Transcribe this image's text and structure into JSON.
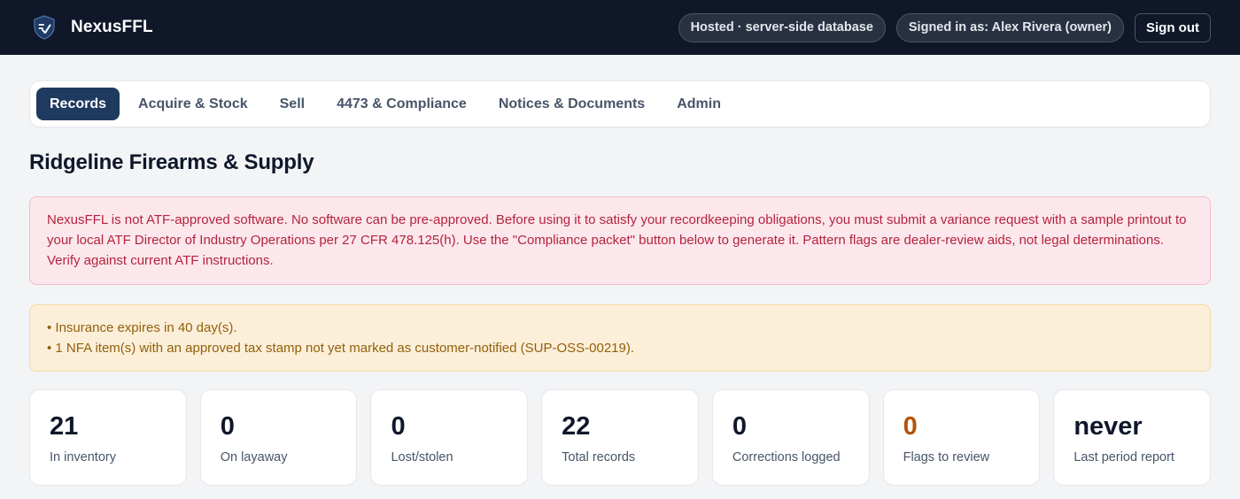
{
  "app": {
    "name": "NexusFFL",
    "logo_icon": "shield-check-icon"
  },
  "header": {
    "hosting_badge": "Hosted · server-side database",
    "signed_in_badge": "Signed in as: Alex Rivera (owner)",
    "sign_out_label": "Sign out"
  },
  "tabs": [
    {
      "label": "Records",
      "active": true
    },
    {
      "label": "Acquire & Stock",
      "active": false
    },
    {
      "label": "Sell",
      "active": false
    },
    {
      "label": "4473 & Compliance",
      "active": false
    },
    {
      "label": "Notices & Documents",
      "active": false
    },
    {
      "label": "Admin",
      "active": false
    }
  ],
  "page": {
    "title": "Ridgeline Firearms & Supply"
  },
  "alerts": {
    "danger_text": "NexusFFL is not ATF-approved software. No software can be pre-approved. Before using it to satisfy your recordkeeping obligations, you must submit a variance request with a sample printout to your local ATF Director of Industry Operations per 27 CFR 478.125(h). Use the \"Compliance packet\" button below to generate it. Pattern flags are dealer-review aids, not legal determinations. Verify against current ATF instructions.",
    "warnings": [
      "• Insurance expires in 40 day(s).",
      "• 1 NFA item(s) with an approved tax stamp not yet marked as customer-notified (SUP-OSS-00219)."
    ]
  },
  "stats": [
    {
      "value": "21",
      "label": "In inventory"
    },
    {
      "value": "0",
      "label": "On layaway"
    },
    {
      "value": "0",
      "label": "Lost/stolen"
    },
    {
      "value": "22",
      "label": "Total records"
    },
    {
      "value": "0",
      "label": "Corrections logged"
    },
    {
      "value": "0",
      "label": "Flags to review",
      "highlight_color": "#b45309"
    },
    {
      "value": "never",
      "label": "Last period report"
    }
  ],
  "colors": {
    "topbar_bg": "#0f1729",
    "active_tab_bg": "#1e3a5f",
    "danger_text": "#b4233f",
    "warning_text": "#92600a"
  }
}
